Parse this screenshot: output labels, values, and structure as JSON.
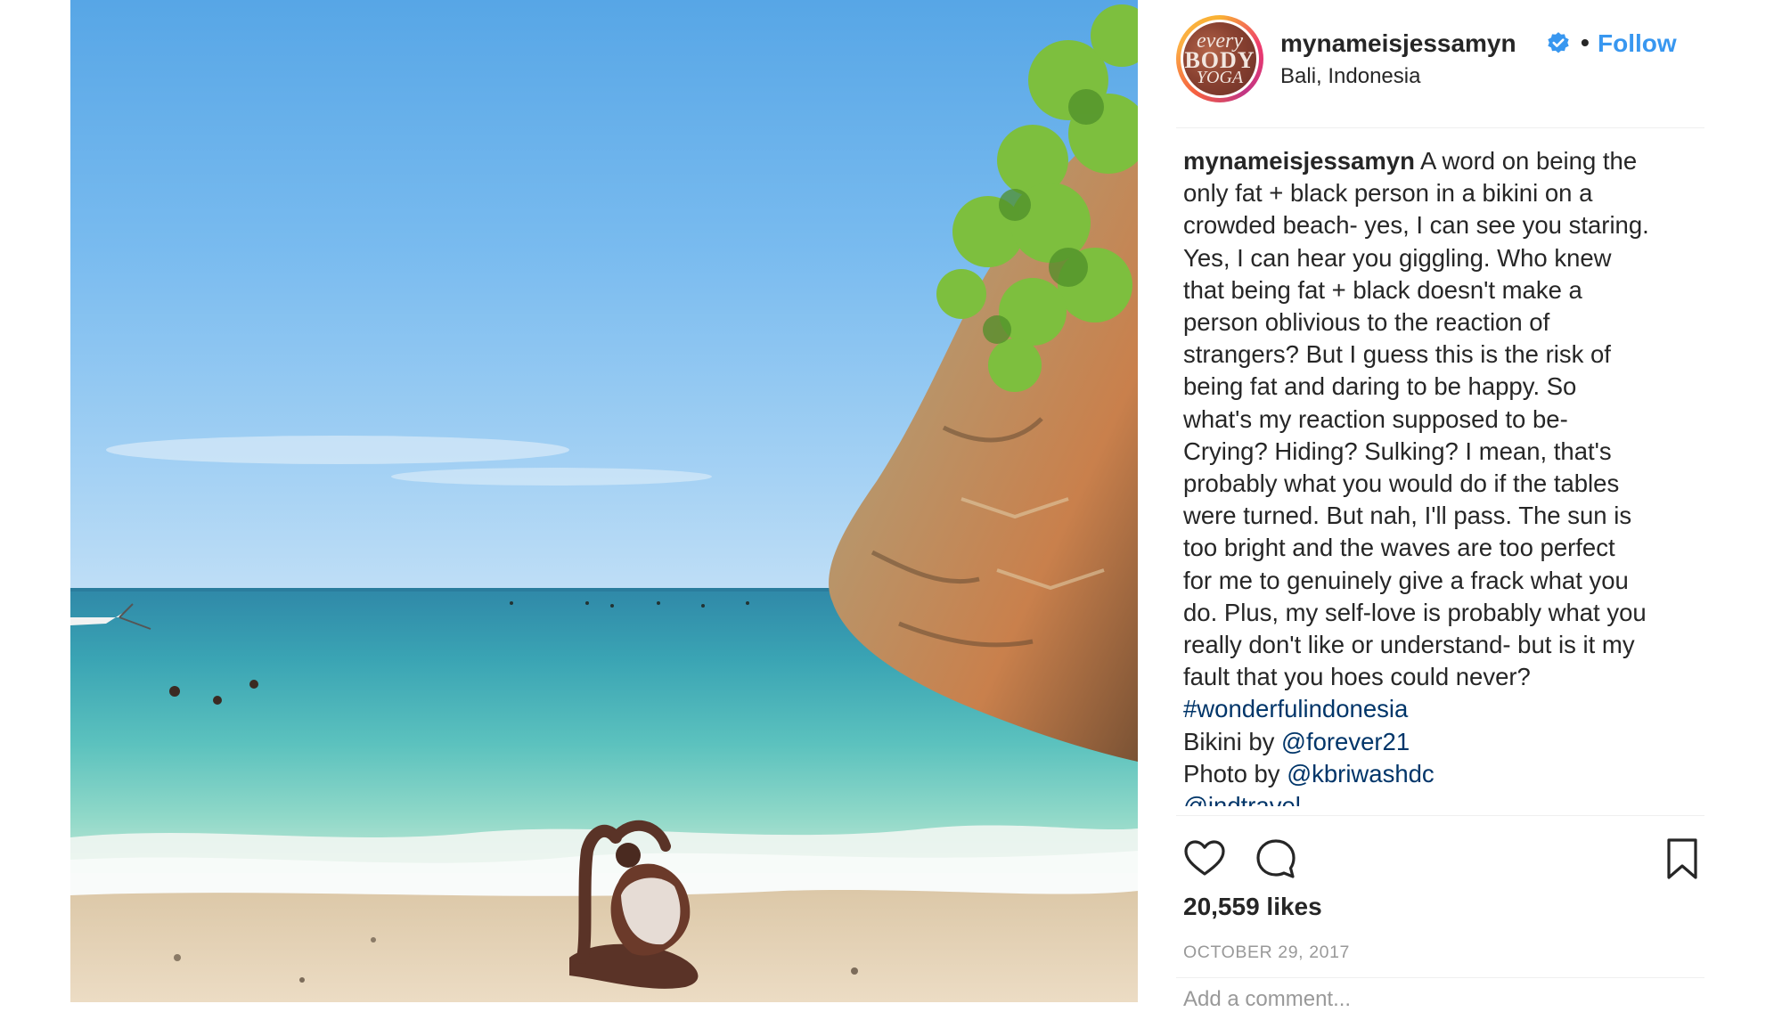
{
  "post": {
    "username": "mynameisjessamyn",
    "follow_label": "Follow",
    "separator": "•",
    "location": "Bali, Indonesia",
    "avatar_text": [
      "every",
      "BODY",
      "YOGA"
    ]
  },
  "caption": {
    "username": "mynameisjessamyn",
    "first_line_rest": " A word on being the",
    "lines": [
      "only fat + black person in a bikini on a",
      "crowded beach- yes, I can see you staring.",
      "Yes, I can hear you giggling. Who knew",
      "that being fat + black doesn't make a",
      "person oblivious to the reaction of",
      "strangers? But I guess this is the risk of",
      "being fat and daring to be happy. So",
      "what's my reaction supposed to be-",
      "Crying? Hiding? Sulking? I mean, that's",
      "probably what you would do if the tables",
      "were turned. But nah, I'll pass. The sun is",
      "too bright and the waves are too perfect",
      "for me to genuinely give a frack what you",
      "do. Plus, my self-love is probably what you",
      "really don't like or understand- but is it my",
      "fault that you hoes could never?"
    ],
    "hashtag": "#wonderfulindonesia",
    "bikini_prefix": "Bikini by ",
    "bikini_handle": "@forever21",
    "photo_prefix": "Photo by ",
    "photo_handle": "@kbriwashdc",
    "travel_handle": "@indtravel"
  },
  "stats": {
    "likes": "20,559 likes",
    "date": "OCTOBER 29, 2017"
  },
  "comment": {
    "placeholder": "Add a comment..."
  },
  "colors": {
    "link_blue": "#3897f0",
    "hashtag_blue": "#003569",
    "text": "#262626",
    "muted": "#999999"
  },
  "icons": [
    "heart-icon",
    "comment-icon",
    "bookmark-icon",
    "verified-badge-icon"
  ]
}
